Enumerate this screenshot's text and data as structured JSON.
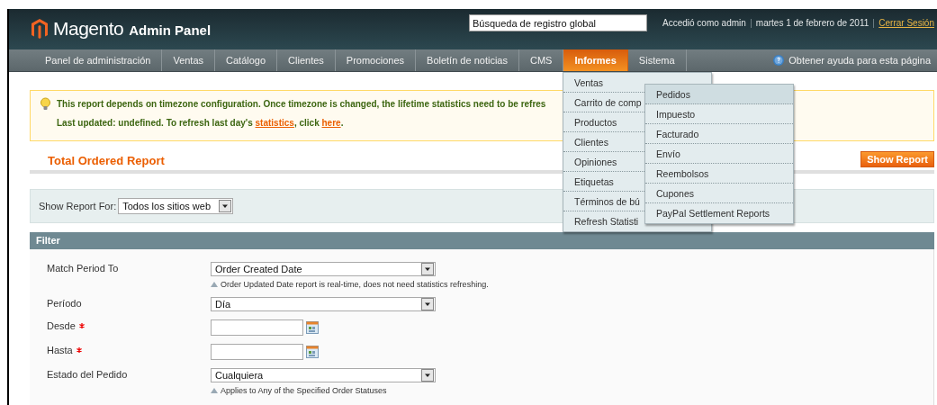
{
  "header": {
    "logo": {
      "name": "Magento",
      "suffix": "Admin Panel"
    },
    "search": {
      "placeholder": "Búsqueda de registro global"
    },
    "user_info": [
      "Accedió como admin",
      "martes 1 de febrero de 2011"
    ],
    "logout": "Cerrar Sesión"
  },
  "nav": {
    "items": [
      {
        "label": "Panel de administración",
        "selected": false
      },
      {
        "label": "Ventas",
        "selected": false
      },
      {
        "label": "Catálogo",
        "selected": false
      },
      {
        "label": "Clientes",
        "selected": false
      },
      {
        "label": "Promociones",
        "selected": false
      },
      {
        "label": "Boletín de noticias",
        "selected": false
      },
      {
        "label": "CMS",
        "selected": false
      },
      {
        "label": "Informes",
        "selected": true
      },
      {
        "label": "Sistema",
        "selected": false
      }
    ],
    "help": "Obtener ayuda para esta página",
    "dropdown": [
      {
        "label": "Ventas",
        "selected": false
      },
      {
        "label": "Carrito de comp",
        "selected": false
      },
      {
        "label": "Productos",
        "selected": false
      },
      {
        "label": "Clientes",
        "selected": false
      },
      {
        "label": "Opiniones",
        "selected": false
      },
      {
        "label": "Etiquetas",
        "selected": false
      },
      {
        "label": "Términos de bú",
        "selected": false
      },
      {
        "label": "Refresh Statisti",
        "selected": false
      }
    ],
    "submenu": [
      {
        "label": "Pedidos",
        "selected": true
      },
      {
        "label": "Impuesto",
        "selected": false
      },
      {
        "label": "Facturado",
        "selected": false
      },
      {
        "label": "Envío",
        "selected": false
      },
      {
        "label": "Reembolsos",
        "selected": false
      },
      {
        "label": "Cupones",
        "selected": false
      },
      {
        "label": "PayPal Settlement Reports",
        "selected": false
      }
    ]
  },
  "notice": {
    "message": "This report depends on timezone configuration. Once timezone is changed, the lifetime statistics need to be refres",
    "refresh_line": [
      {
        "kind": "text",
        "text": "Last updated: undefined. To refresh last day's "
      },
      {
        "kind": "link",
        "text": "statistics"
      },
      {
        "kind": "text",
        "text": ", click "
      },
      {
        "kind": "link",
        "text": "here"
      },
      {
        "kind": "text",
        "text": "."
      }
    ]
  },
  "page_title": "Total Ordered Report",
  "show_report_button": "Show Report",
  "store_switcher": {
    "label": "Show Report For:",
    "value": "Todos los sitios web"
  },
  "filter": {
    "title": "Filter",
    "fields": [
      {
        "label": "Match Period To",
        "kind": "select",
        "required": false,
        "value": "Order Created Date",
        "note": "Order Updated Date report is real-time, does not need statistics refreshing."
      },
      {
        "label": "Período",
        "kind": "select",
        "required": false,
        "value": "Día"
      },
      {
        "label": "Desde",
        "kind": "date",
        "required": true
      },
      {
        "label": "Hasta",
        "kind": "date",
        "required": true
      },
      {
        "label": "Estado del Pedido",
        "kind": "select",
        "required": false,
        "value": "Cualquiera",
        "note": "Applies to Any of the Specified Order Statuses"
      }
    ]
  }
}
